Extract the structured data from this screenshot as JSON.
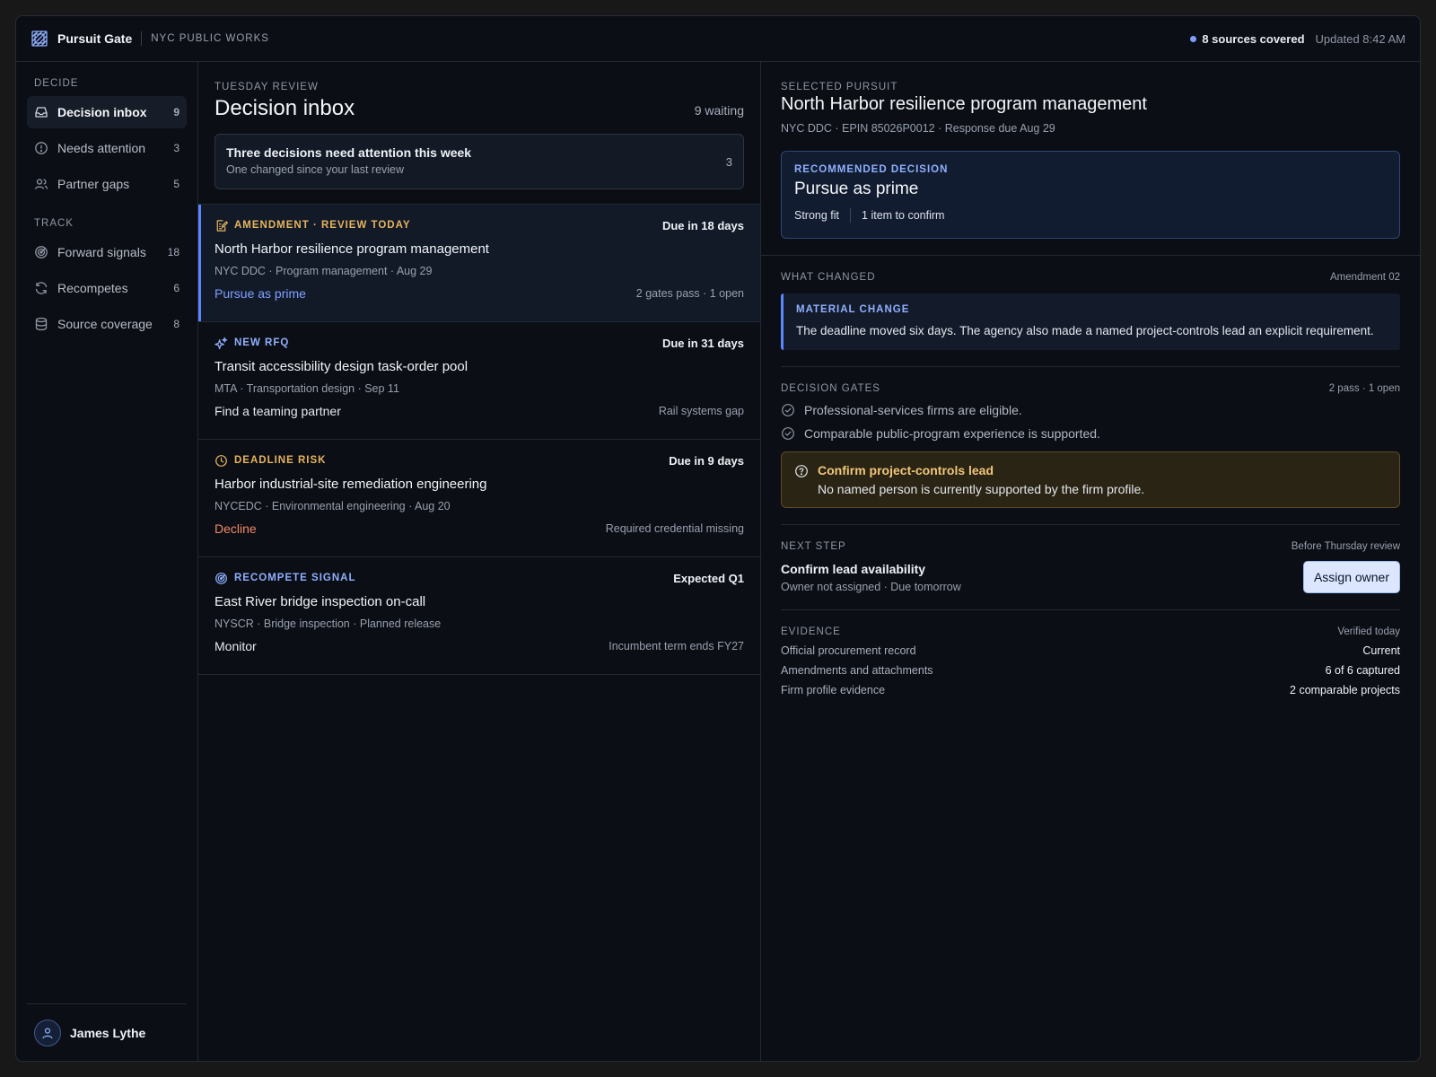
{
  "app": {
    "name": "Pursuit Gate",
    "org": "NYC PUBLIC WORKS",
    "sources": "8 sources covered",
    "updated": "Updated 8:42 AM"
  },
  "sidebar": {
    "decide_label": "DECIDE",
    "track_label": "TRACK",
    "items": [
      {
        "label": "Decision inbox",
        "count": "9"
      },
      {
        "label": "Needs attention",
        "count": "3"
      },
      {
        "label": "Partner gaps",
        "count": "5"
      },
      {
        "label": "Forward signals",
        "count": "18"
      },
      {
        "label": "Recompetes",
        "count": "6"
      },
      {
        "label": "Source coverage",
        "count": "8"
      }
    ],
    "user": "James Lythe"
  },
  "inbox": {
    "eyebrow": "TUESDAY REVIEW",
    "title": "Decision inbox",
    "waiting": "9 waiting",
    "callout": {
      "title": "Three decisions need attention this week",
      "sub": "One changed since your last review",
      "count": "3"
    },
    "cards": [
      {
        "tag": "AMENDMENT · REVIEW TODAY",
        "due": "Due in 18 days",
        "title": "North Harbor resilience program management",
        "meta": "NYC DDC · Program management · Aug 29",
        "action": "Pursue as prime",
        "note": "2 gates pass · 1 open"
      },
      {
        "tag": "NEW RFQ",
        "due": "Due in 31 days",
        "title": "Transit accessibility design task-order pool",
        "meta": "MTA · Transportation design · Sep 11",
        "action": "Find a teaming partner",
        "note": "Rail systems gap"
      },
      {
        "tag": "DEADLINE RISK",
        "due": "Due in 9 days",
        "title": "Harbor industrial-site remediation engineering",
        "meta": "NYCEDC · Environmental engineering · Aug 20",
        "action": "Decline",
        "note": "Required credential missing"
      },
      {
        "tag": "RECOMPETE SIGNAL",
        "due": "Expected Q1",
        "title": "East River bridge inspection on-call",
        "meta": "NYSCR · Bridge inspection · Planned release",
        "action": "Monitor",
        "note": "Incumbent term ends FY27"
      }
    ]
  },
  "detail": {
    "eyebrow": "SELECTED PURSUIT",
    "title": "North Harbor resilience program management",
    "meta": "NYC DDC · EPIN 85026P0012 · Response due Aug 29",
    "recommended": {
      "label": "RECOMMENDED DECISION",
      "title": "Pursue as prime",
      "fit": "Strong fit",
      "confirm": "1 item to confirm"
    },
    "what_changed": {
      "label": "WHAT CHANGED",
      "right": "Amendment 02",
      "box_label": "MATERIAL CHANGE",
      "text": "The deadline moved six days. The agency also made a named project-controls lead an explicit requirement."
    },
    "gates": {
      "label": "DECISION GATES",
      "right": "2 pass · 1 open",
      "items": [
        "Professional-services firms are eligible.",
        "Comparable public-program experience is supported."
      ],
      "open_title": "Confirm project-controls lead",
      "open_sub": "No named person is currently supported by the firm profile."
    },
    "next_step": {
      "label": "NEXT STEP",
      "right": "Before Thursday review",
      "title": "Confirm lead availability",
      "sub": "Owner not assigned · Due tomorrow",
      "button": "Assign owner"
    },
    "evidence": {
      "label": "EVIDENCE",
      "right": "Verified today",
      "rows": [
        {
          "label": "Official procurement record",
          "value": "Current"
        },
        {
          "label": "Amendments and attachments",
          "value": "6 of 6 captured"
        },
        {
          "label": "Firm profile evidence",
          "value": "2 comparable projects"
        }
      ]
    }
  },
  "colors": {
    "accent": "#5c86ff",
    "amendment": "#e7b45e",
    "new_rfq": "#8fb0ff",
    "deadline": "#e7b45e",
    "recompete": "#8fb0ff",
    "decline": "#f08a6a",
    "pursue": "#7da0ff"
  }
}
